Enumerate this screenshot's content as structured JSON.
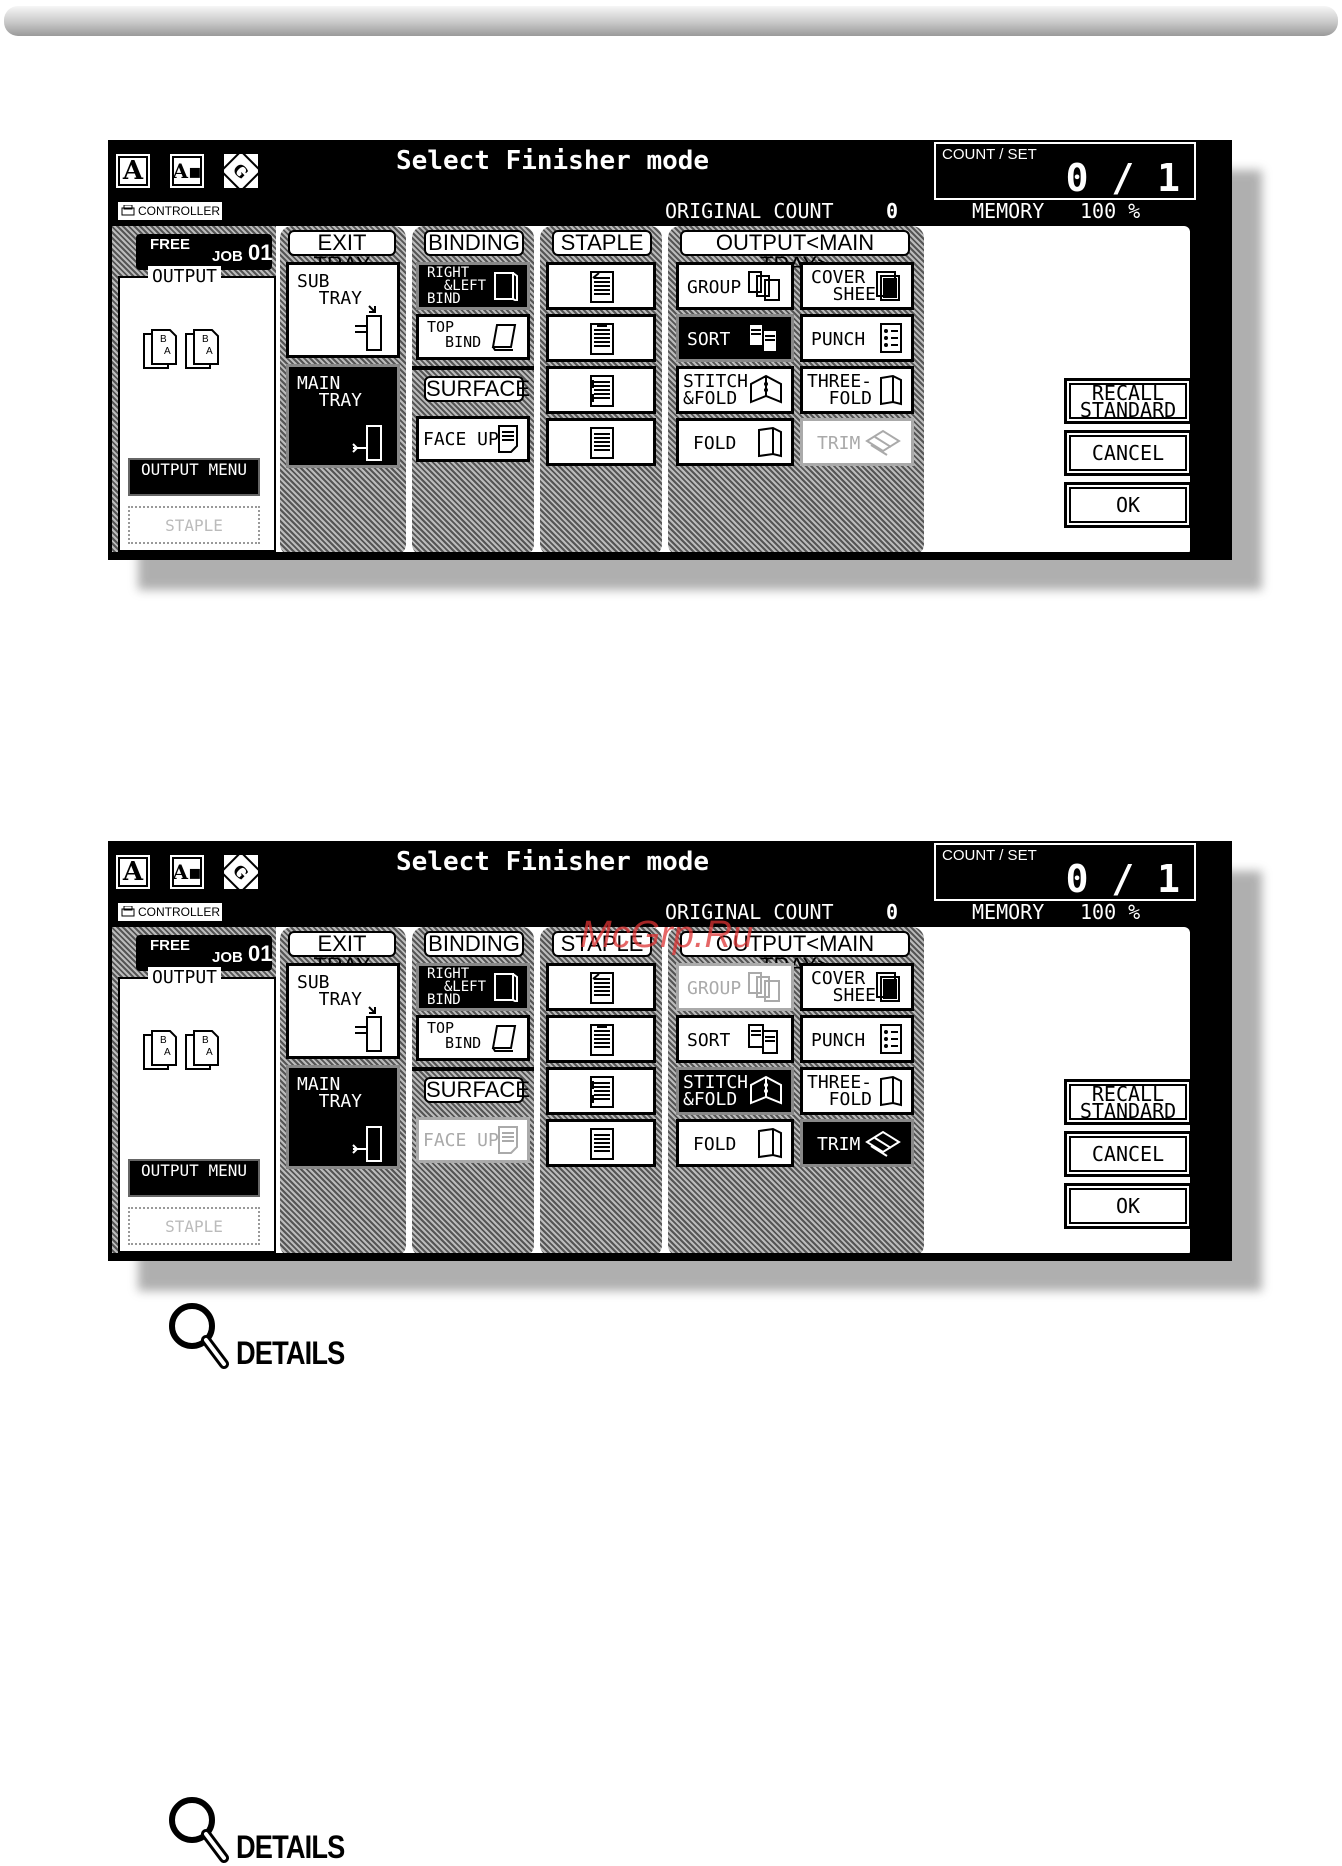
{
  "screens": [
    {
      "title": "Select Finisher mode",
      "controller": "CONTROLLER",
      "count_set_label": "COUNT / SET",
      "count_set_value": "0 / 1",
      "original_count_label": "ORIGINAL COUNT",
      "original_count_value": "0",
      "memory_label": "MEMORY",
      "memory_value": "100 %",
      "free_label": "FREE",
      "job_label": "JOB",
      "job_number": "01",
      "output_label": "OUTPUT",
      "output_menu_label": "OUTPUT MENU",
      "staple_side_label": "STAPLE",
      "exit_tray": {
        "header": "EXIT TRAY",
        "sub_tray": "SUB\n  TRAY",
        "main_tray": "MAIN\n  TRAY",
        "selected": "main"
      },
      "binding": {
        "header": "BINDING",
        "right_left": "RIGHT\n  &LEFT\nBIND",
        "top_bind": "TOP\n  BIND"
      },
      "surface": {
        "header": "SURFACE",
        "face_up": "FACE UP",
        "face_up_disabled": false
      },
      "staple": {
        "header": "STAPLE"
      },
      "output_main": {
        "header": "OUTPUT<MAIN TRAY>",
        "group": "GROUP",
        "group_selected": false,
        "group_disabled": false,
        "cover_sheet": "COVER\n  SHEET",
        "sort": "SORT",
        "sort_selected": true,
        "punch": "PUNCH",
        "stitch_fold": "STITCH\n&FOLD",
        "stitch_selected": false,
        "three_fold": "THREE-\n  FOLD",
        "fold": "FOLD",
        "trim": "TRIM",
        "trim_selected": false,
        "trim_disabled": true
      },
      "recall_standard": "RECALL\nSTANDARD",
      "cancel": "CANCEL",
      "ok": "OK"
    },
    {
      "title": "Select Finisher mode",
      "controller": "CONTROLLER",
      "count_set_label": "COUNT / SET",
      "count_set_value": "0 / 1",
      "original_count_label": "ORIGINAL COUNT",
      "original_count_value": "0",
      "memory_label": "MEMORY",
      "memory_value": "100 %",
      "free_label": "FREE",
      "job_label": "JOB",
      "job_number": "01",
      "output_label": "OUTPUT",
      "output_menu_label": "OUTPUT MENU",
      "staple_side_label": "STAPLE",
      "exit_tray": {
        "header": "EXIT TRAY",
        "sub_tray": "SUB\n  TRAY",
        "main_tray": "MAIN\n  TRAY",
        "selected": "main"
      },
      "binding": {
        "header": "BINDING",
        "right_left": "RIGHT\n  &LEFT\nBIND",
        "top_bind": "TOP\n  BIND"
      },
      "surface": {
        "header": "SURFACE",
        "face_up": "FACE UP",
        "face_up_disabled": true
      },
      "staple": {
        "header": "STAPLE"
      },
      "output_main": {
        "header": "OUTPUT<MAIN TRAY>",
        "group": "GROUP",
        "group_selected": false,
        "group_disabled": true,
        "cover_sheet": "COVER\n  SHEET",
        "sort": "SORT",
        "sort_selected": false,
        "punch": "PUNCH",
        "stitch_fold": "STITCH\n&FOLD",
        "stitch_selected": true,
        "three_fold": "THREE-\n  FOLD",
        "fold": "FOLD",
        "trim": "TRIM",
        "trim_selected": true,
        "trim_disabled": false
      },
      "recall_standard": "RECALL\nSTANDARD",
      "cancel": "CANCEL",
      "ok": "OK"
    }
  ],
  "watermark": "McGrp.Ru",
  "details_label": "DETAILS",
  "icons": [
    "magnifier-icon",
    "document-a-icon",
    "photo-icon",
    "rotate-icon",
    "printer-icon"
  ]
}
